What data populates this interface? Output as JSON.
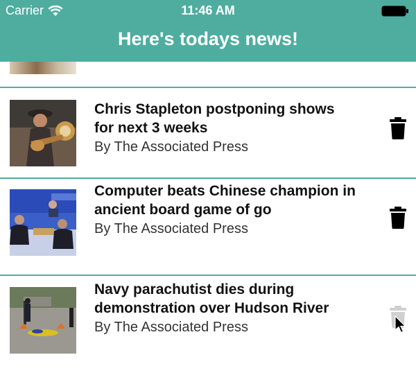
{
  "status_bar": {
    "carrier": "Carrier",
    "time": "11:46 AM",
    "wifi_icon": "wifi-icon",
    "battery_icon": "battery-icon"
  },
  "nav": {
    "title": "Here's todays news!",
    "background": "#4fada0"
  },
  "articles": [
    {
      "headline": "Chris Stapleton postponing shows for next 3 weeks",
      "byline": "By The Associated Press",
      "action_icon": "trash-icon"
    },
    {
      "headline": "Computer beats Chinese champion in ancient board game of go",
      "byline": "By The Associated Press",
      "action_icon": "trash-icon"
    },
    {
      "headline": "Navy parachutist dies during demonstration over Hudson River",
      "byline": "By The Associated Press",
      "action_icon": "trash-icon"
    }
  ],
  "colors": {
    "separator": "#4fada0",
    "trash": "#000000",
    "trash_pressed": "#d0d0d0"
  }
}
